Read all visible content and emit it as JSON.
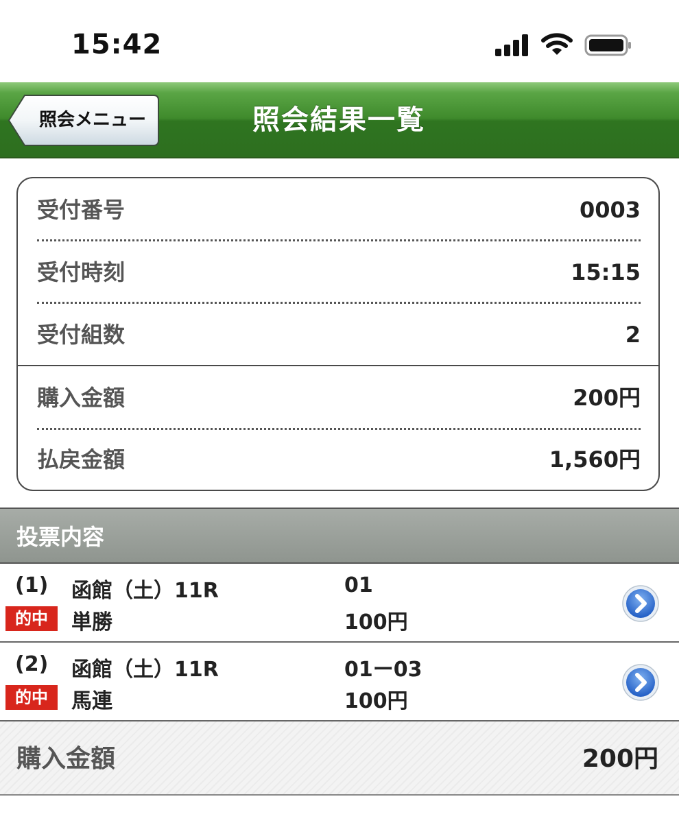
{
  "status_bar": {
    "time": "15:42",
    "icons": [
      "signal-icon",
      "wifi-icon",
      "battery-icon"
    ]
  },
  "nav": {
    "back_label": "照会メニュー",
    "title": "照会結果一覧"
  },
  "info": {
    "rows": [
      {
        "label": "受付番号",
        "value": "0003"
      },
      {
        "label": "受付時刻",
        "value": "15:15"
      },
      {
        "label": "受付組数",
        "value": "2"
      },
      {
        "label": "購入金額",
        "value": "200円"
      },
      {
        "label": "払戻金額",
        "value": "1,560円"
      }
    ]
  },
  "section": {
    "title": "投票内容"
  },
  "bets": [
    {
      "num": "(1)",
      "place": "函館（土）11R",
      "combo": "01",
      "badge": "的中",
      "type": "単勝",
      "amount": "100円"
    },
    {
      "num": "(2)",
      "place": "函館（土）11R",
      "combo": "01ー03",
      "badge": "的中",
      "type": "馬連",
      "amount": "100円"
    }
  ],
  "total": {
    "label": "購入金額",
    "value": "200円"
  },
  "colors": {
    "nav_green": "#3f8a2c",
    "hit_red": "#d8261c",
    "chevron_blue": "#2f6fd6"
  }
}
